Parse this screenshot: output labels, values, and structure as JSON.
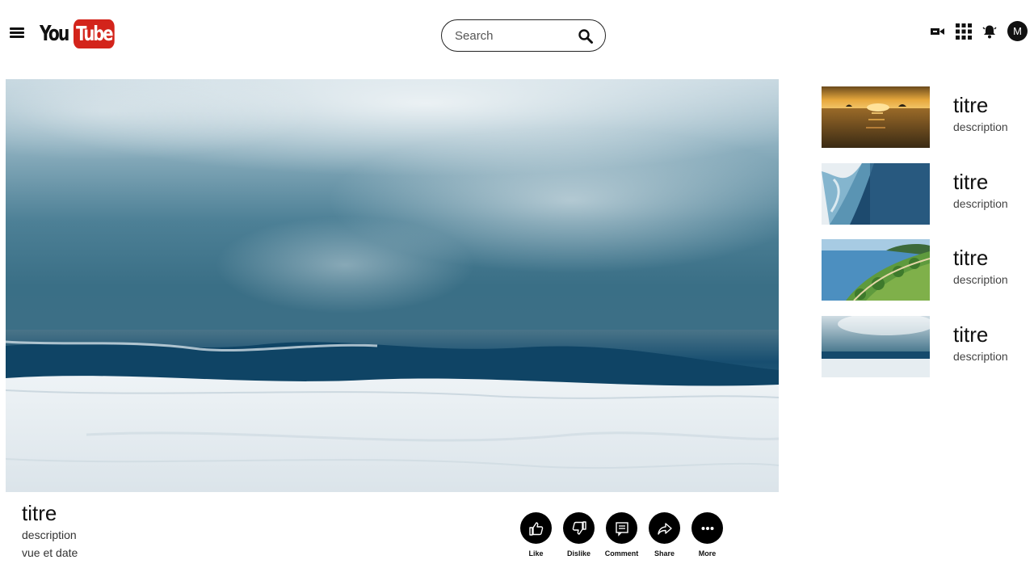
{
  "header": {
    "menu_icon": "hamburger-menu-icon",
    "logo": {
      "you": "You",
      "tube": "Tube",
      "brand_color": "#d3241b"
    },
    "search": {
      "placeholder": "Search",
      "icon": "search-icon"
    },
    "icons": [
      "video-camera-icon",
      "apps-grid-icon",
      "bell-icon"
    ],
    "avatar_initial": "M"
  },
  "video": {
    "title": "titre",
    "description": "description",
    "meta": "vue et date"
  },
  "actions": [
    {
      "label": "Like",
      "icon": "thumbs-up-icon"
    },
    {
      "label": "Dislike",
      "icon": "thumbs-down-icon"
    },
    {
      "label": "Comment",
      "icon": "comment-icon"
    },
    {
      "label": "Share",
      "icon": "share-icon"
    },
    {
      "label": "More",
      "icon": "more-dots-icon"
    }
  ],
  "related": [
    {
      "title": "titre",
      "description": "description",
      "thumb": "sunset-sea"
    },
    {
      "title": "titre",
      "description": "description",
      "thumb": "aerial-waves"
    },
    {
      "title": "titre",
      "description": "description",
      "thumb": "palm-coast"
    },
    {
      "title": "titre",
      "description": "description",
      "thumb": "stormy-sea"
    }
  ]
}
